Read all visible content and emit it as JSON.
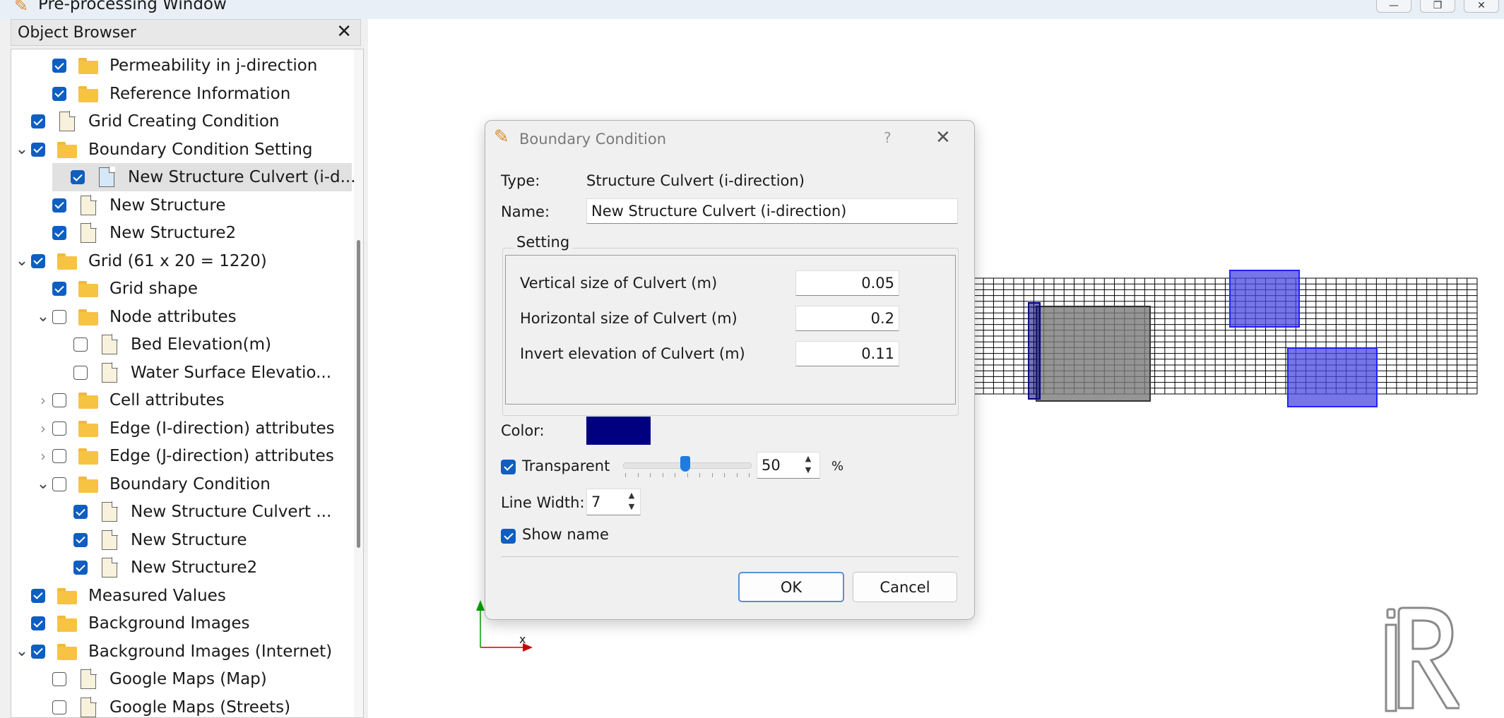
{
  "window": {
    "title": "Pre-processing Window",
    "buttons": [
      "minimize",
      "restore",
      "close"
    ]
  },
  "object_browser": {
    "title": "Object Browser",
    "close_icon": "close-icon",
    "items": [
      {
        "label": "Permeability in j-direction",
        "level": 2,
        "checked": true,
        "icon": "folder-icon"
      },
      {
        "label": "Reference Information",
        "level": 2,
        "checked": true,
        "icon": "folder-icon"
      },
      {
        "label": "Grid Creating Condition",
        "level": 1,
        "checked": true,
        "icon": "document-icon"
      },
      {
        "label": "Boundary Condition Setting",
        "level": 1,
        "checked": true,
        "icon": "folder-icon",
        "expanded": true
      },
      {
        "label": "New Structure Culvert (i-d...",
        "level": 2,
        "checked": true,
        "icon": "document-icon",
        "selected": true
      },
      {
        "label": "New Structure",
        "level": 2,
        "checked": true,
        "icon": "document-icon"
      },
      {
        "label": "New Structure2",
        "level": 2,
        "checked": true,
        "icon": "document-icon"
      },
      {
        "label": "Grid (61 x 20 = 1220)",
        "level": 1,
        "checked": true,
        "icon": "folder-icon",
        "expanded": true
      },
      {
        "label": "Grid shape",
        "level": 2,
        "checked": true,
        "icon": "folder-icon"
      },
      {
        "label": "Node attributes",
        "level": 2,
        "checked": false,
        "icon": "folder-icon",
        "expanded": true
      },
      {
        "label": "Bed Elevation(m)",
        "level": 3,
        "checked": false,
        "icon": "document-icon"
      },
      {
        "label": "Water Surface Elevatio...",
        "level": 3,
        "checked": false,
        "icon": "document-icon"
      },
      {
        "label": "Cell attributes",
        "level": 2,
        "checked": false,
        "icon": "folder-icon",
        "collapsed": true
      },
      {
        "label": "Edge (I-direction) attributes",
        "level": 2,
        "checked": false,
        "icon": "folder-icon",
        "collapsed": true
      },
      {
        "label": "Edge (J-direction) attributes",
        "level": 2,
        "checked": false,
        "icon": "folder-icon",
        "collapsed": true
      },
      {
        "label": "Boundary Condition",
        "level": 2,
        "checked": false,
        "icon": "folder-icon",
        "expanded": true
      },
      {
        "label": "New Structure Culvert ...",
        "level": 3,
        "checked": true,
        "icon": "document-icon"
      },
      {
        "label": "New Structure",
        "level": 3,
        "checked": true,
        "icon": "document-icon"
      },
      {
        "label": "New Structure2",
        "level": 3,
        "checked": true,
        "icon": "document-icon"
      },
      {
        "label": "Measured Values",
        "level": 1,
        "checked": true,
        "icon": "folder-icon"
      },
      {
        "label": "Background Images",
        "level": 1,
        "checked": true,
        "icon": "folder-icon"
      },
      {
        "label": "Background Images (Internet)",
        "level": 1,
        "checked": true,
        "icon": "folder-icon",
        "expanded": true
      },
      {
        "label": "Google Maps (Map)",
        "level": 2,
        "checked": false,
        "icon": "document-icon"
      },
      {
        "label": "Google Maps (Streets)",
        "level": 2,
        "checked": false,
        "icon": "document-icon"
      }
    ]
  },
  "dialog": {
    "title": "Boundary Condition",
    "help": "?",
    "type_label": "Type:",
    "type_value": "Structure Culvert (i-direction)",
    "name_label": "Name:",
    "name_value": "New Structure Culvert (i-direction)",
    "group_title": "Setting",
    "settings": [
      {
        "label": "Vertical size of Culvert (m)",
        "value": "0.05"
      },
      {
        "label": "Horizontal size of Culvert (m)",
        "value": "0.2"
      },
      {
        "label": "Invert elevation of Culvert (m)",
        "value": "0.11"
      }
    ],
    "color_label": "Color:",
    "color_value": "#000080",
    "transparent_label": "Transparent",
    "transparent_checked": true,
    "transparency_value": "50",
    "transparency_fraction": 0.5,
    "percent": "%",
    "line_width_label": "Line Width:",
    "line_width_value": "7",
    "show_name_label": "Show name",
    "show_name_checked": true,
    "ok_label": "OK",
    "cancel_label": "Cancel"
  },
  "canvas": {
    "axis_x_label": "x",
    "grid_color": "#000000",
    "culvert_color": "#000080",
    "structure_color": "#4848e0",
    "gray_structure_color": "#7a7a7a",
    "logo": "iRIC logo"
  }
}
